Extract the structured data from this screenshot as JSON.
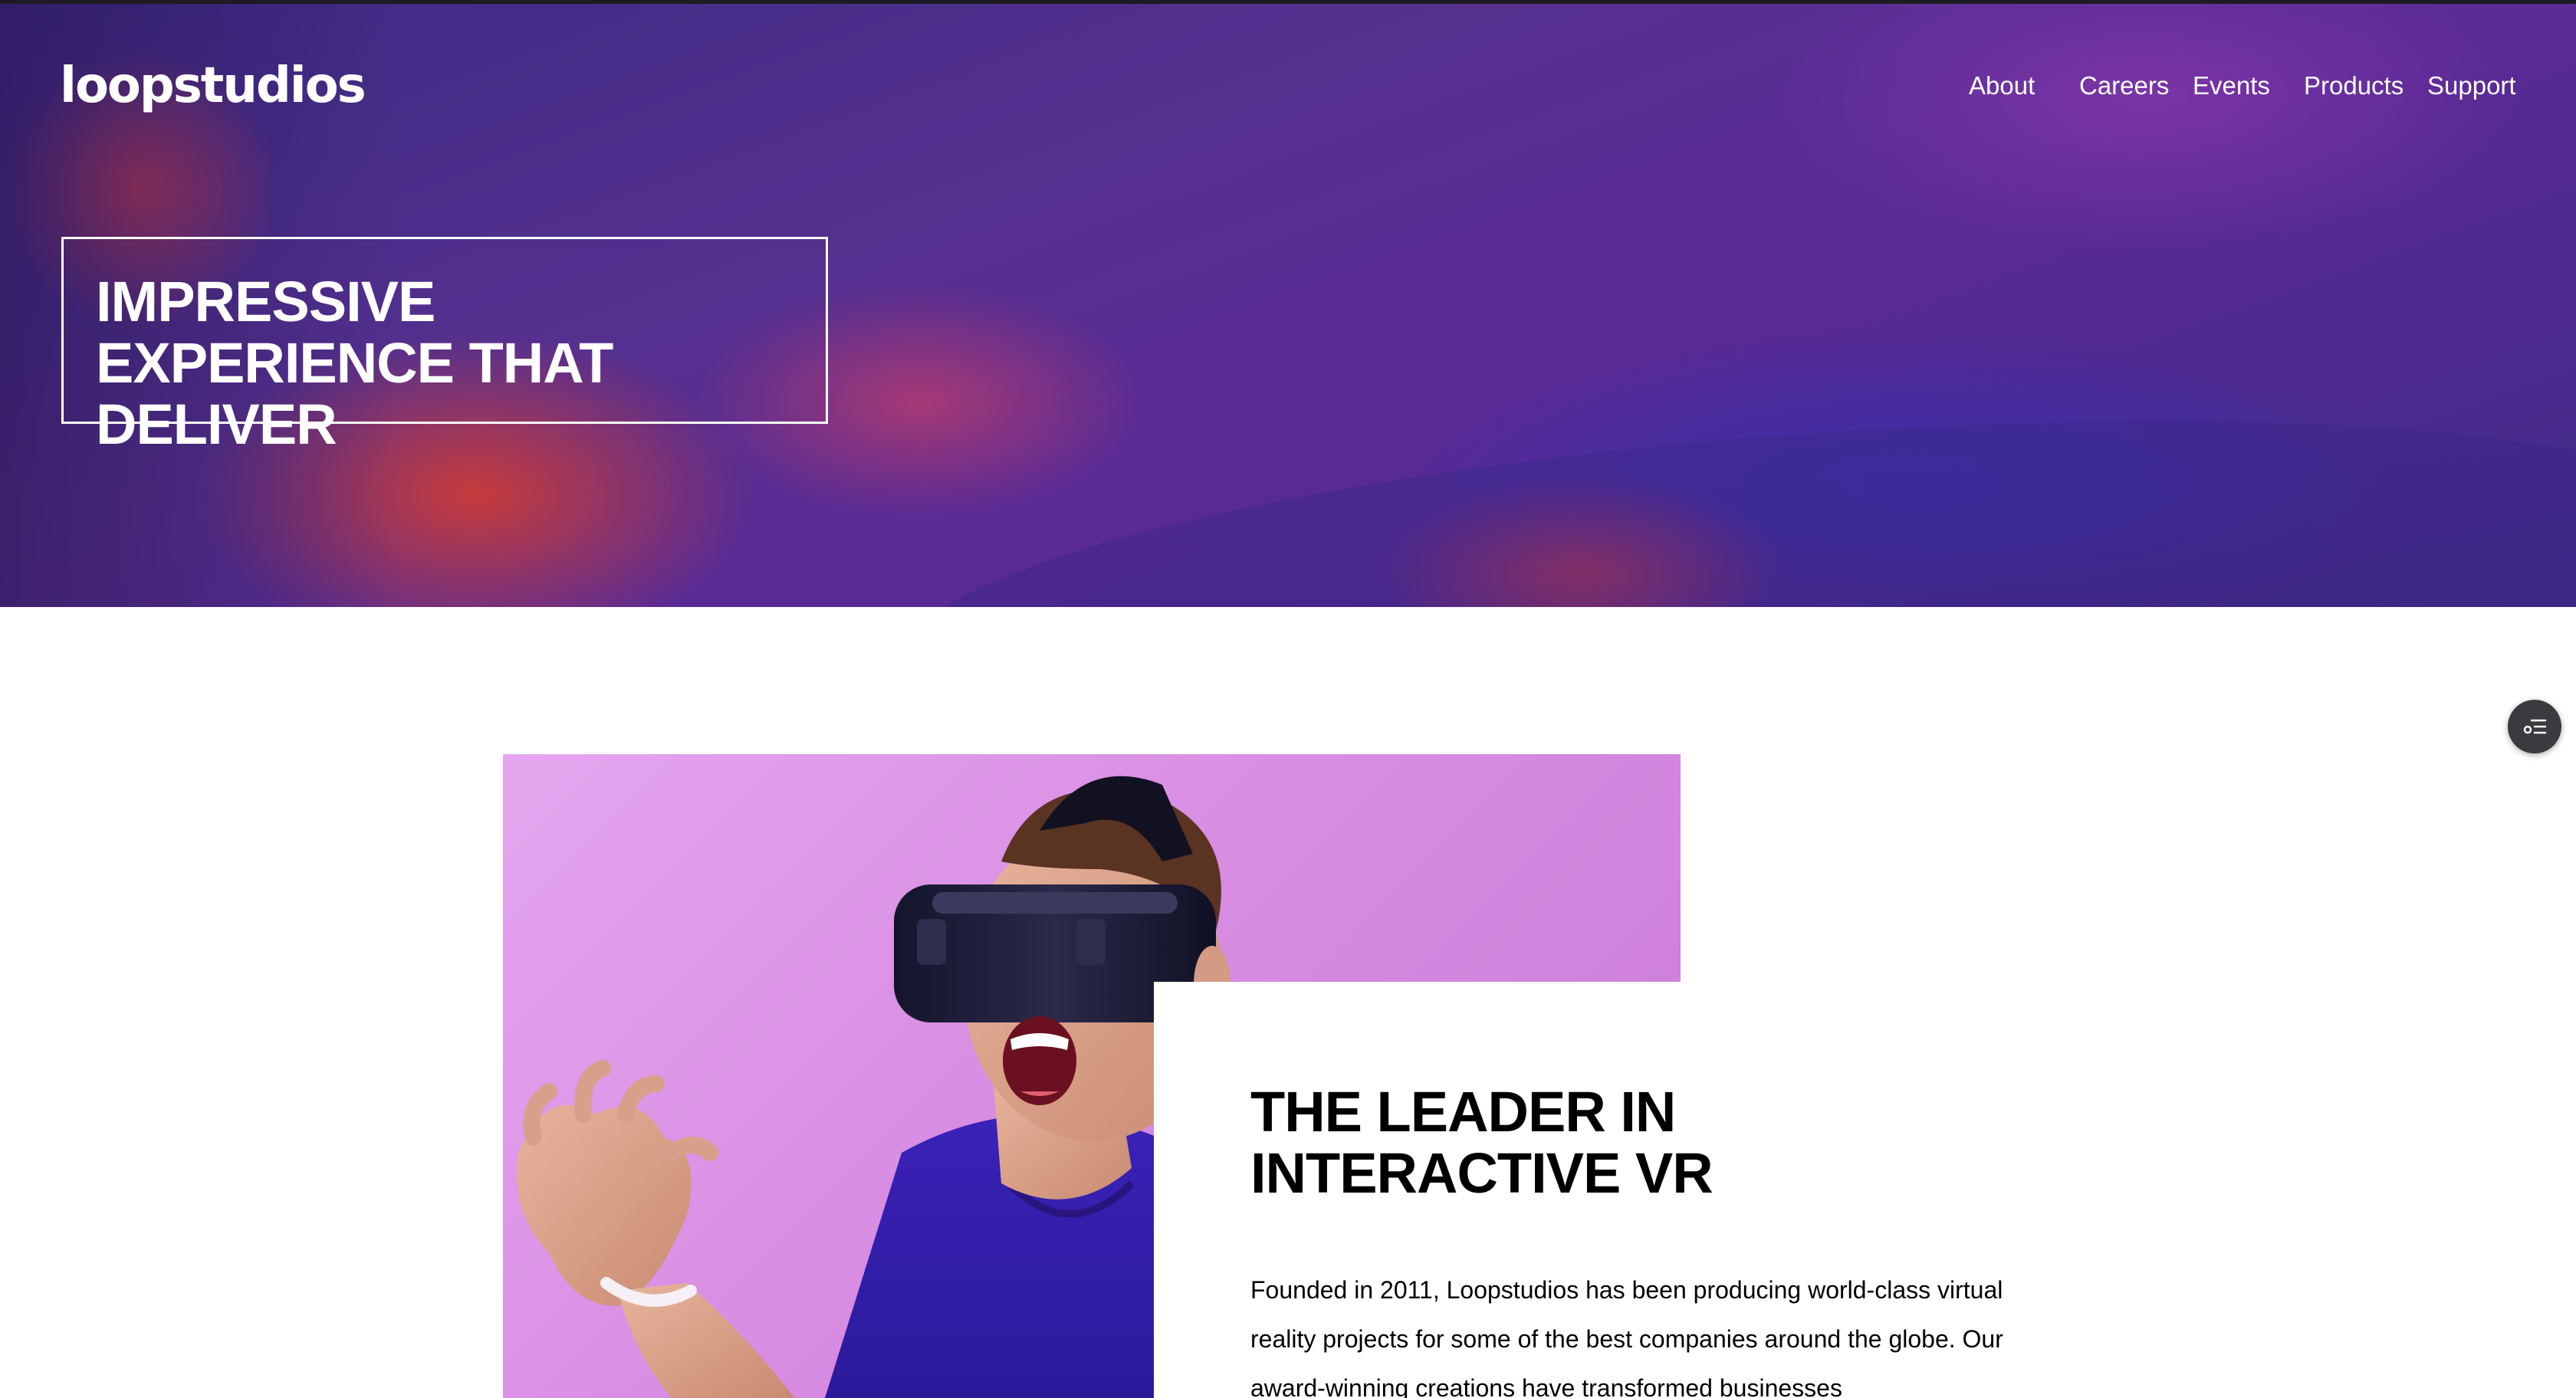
{
  "brand": {
    "logo": "loopstudios"
  },
  "nav": {
    "items": [
      {
        "label": "About"
      },
      {
        "label": "Careers"
      },
      {
        "label": "Events"
      },
      {
        "label": "Products"
      },
      {
        "label": "Support"
      }
    ]
  },
  "hero": {
    "title": "IMPRESSIVE EXPERIENCE THAT DELIVER"
  },
  "intro": {
    "title": "THE LEADER IN INTERACTIVE VR",
    "text": "Founded in 2011, Loopstudios has been producing world-class virtual reality projects for some of the best companies around the globe. Our award-winning creations have transformed businesses"
  },
  "widget": {
    "icon": "list-settings-icon"
  },
  "colors": {
    "hero_purple": "#55308f",
    "image_pink": "#d88de2",
    "text": "#000000"
  }
}
